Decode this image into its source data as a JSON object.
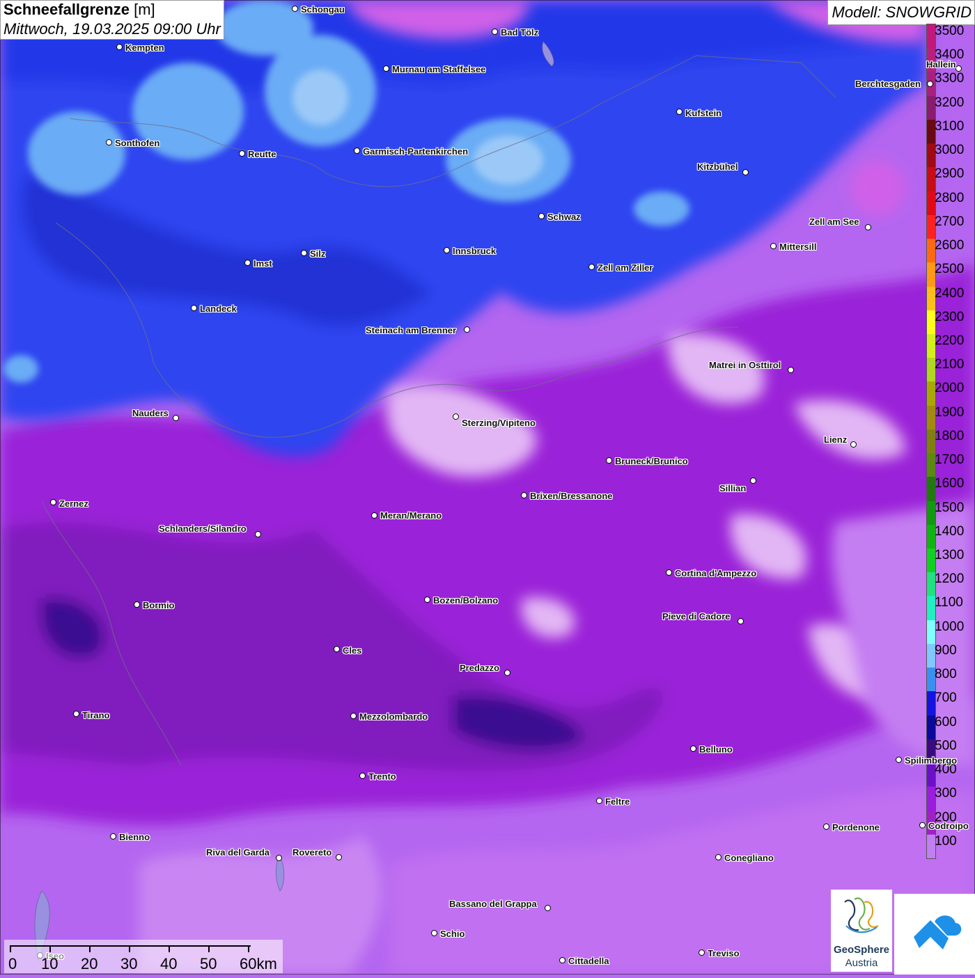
{
  "title": {
    "main": "Schneefallgrenze",
    "unit": "[m]",
    "datetime": "Mittwoch, 19.03.2025 09:00 Uhr"
  },
  "model": "Modell: SNOWGRID",
  "legend": {
    "labels": [
      "3500",
      "3400",
      "3300",
      "3200",
      "3100",
      "3000",
      "2900",
      "2800",
      "2700",
      "2600",
      "2500",
      "2400",
      "2300",
      "2200",
      "2100",
      "2000",
      "1900",
      "1800",
      "1700",
      "1600",
      "1500",
      "1400",
      "1300",
      "1200",
      "1100",
      "1000",
      "900",
      "800",
      "700",
      "600",
      "500",
      "400",
      "300",
      "200",
      "100"
    ],
    "colors": [
      "#c2187a",
      "#b8207a",
      "#a8207e",
      "#8a1c6e",
      "#6a0a10",
      "#a00a12",
      "#c80c14",
      "#e00a14",
      "#ff2020",
      "#ff6a10",
      "#ff9a14",
      "#ffbe1a",
      "#ffff1a",
      "#d4f01a",
      "#b0d820",
      "#aaa800",
      "#a08a10",
      "#808010",
      "#5a8a10",
      "#207a10",
      "#109a10",
      "#10b410",
      "#10d020",
      "#20e080",
      "#20f0c0",
      "#80ffff",
      "#80c8ff",
      "#3a90f0",
      "#1414e0",
      "#0a0a9a",
      "#3a0a80",
      "#6a10c8",
      "#9a1cdc",
      "#a020c8",
      "#c080f0"
    ]
  },
  "towns": [
    {
      "name": "Schongau"
    },
    {
      "name": "Bad Tölz"
    },
    {
      "name": "Kempten"
    },
    {
      "name": "Murnau am Staffelsee"
    },
    {
      "name": "Hallein"
    },
    {
      "name": "Berchtesgaden"
    },
    {
      "name": "Kufstein"
    },
    {
      "name": "Sonthofen"
    },
    {
      "name": "Reutte"
    },
    {
      "name": "Garmisch-Partenkirchen"
    },
    {
      "name": "Kitzbühel"
    },
    {
      "name": "Schwaz"
    },
    {
      "name": "Zell am See"
    },
    {
      "name": "Mittersill"
    },
    {
      "name": "Innsbruck"
    },
    {
      "name": "Imst"
    },
    {
      "name": "Silz"
    },
    {
      "name": "Zell am Ziller"
    },
    {
      "name": "Landeck"
    },
    {
      "name": "Steinach am Brenner"
    },
    {
      "name": "Matrei in Osttirol"
    },
    {
      "name": "Nauders"
    },
    {
      "name": "Sterzing/Vipiteno"
    },
    {
      "name": "Lienz"
    },
    {
      "name": "Bruneck/Brunico"
    },
    {
      "name": "Sillian"
    },
    {
      "name": "Zernez"
    },
    {
      "name": "Brixen/Bressanone"
    },
    {
      "name": "Meran/Merano"
    },
    {
      "name": "Schlanders/Silandro"
    },
    {
      "name": "Cortina d'Ampezzo"
    },
    {
      "name": "Bozen/Bolzano"
    },
    {
      "name": "Bormio"
    },
    {
      "name": "Pieve di Cadore"
    },
    {
      "name": "Cles"
    },
    {
      "name": "Predazzo"
    },
    {
      "name": "Tirano"
    },
    {
      "name": "Mezzolombardo"
    },
    {
      "name": "Belluno"
    },
    {
      "name": "Spilimbergo"
    },
    {
      "name": "Trento"
    },
    {
      "name": "Feltre"
    },
    {
      "name": "Pordenone"
    },
    {
      "name": "Codroipo"
    },
    {
      "name": "Bienno"
    },
    {
      "name": "Riva del Garda"
    },
    {
      "name": "Rovereto"
    },
    {
      "name": "Conegliano"
    },
    {
      "name": "Bassano del Grappa"
    },
    {
      "name": "Schio"
    },
    {
      "name": "Treviso"
    },
    {
      "name": "Cittadella"
    },
    {
      "name": "Iseo"
    }
  ],
  "scale": {
    "labels": [
      "0",
      "10",
      "20",
      "30",
      "40",
      "50",
      "60km"
    ]
  },
  "logos": {
    "geosphere_line1": "GeoSphere",
    "geosphere_line2": "Austria"
  }
}
